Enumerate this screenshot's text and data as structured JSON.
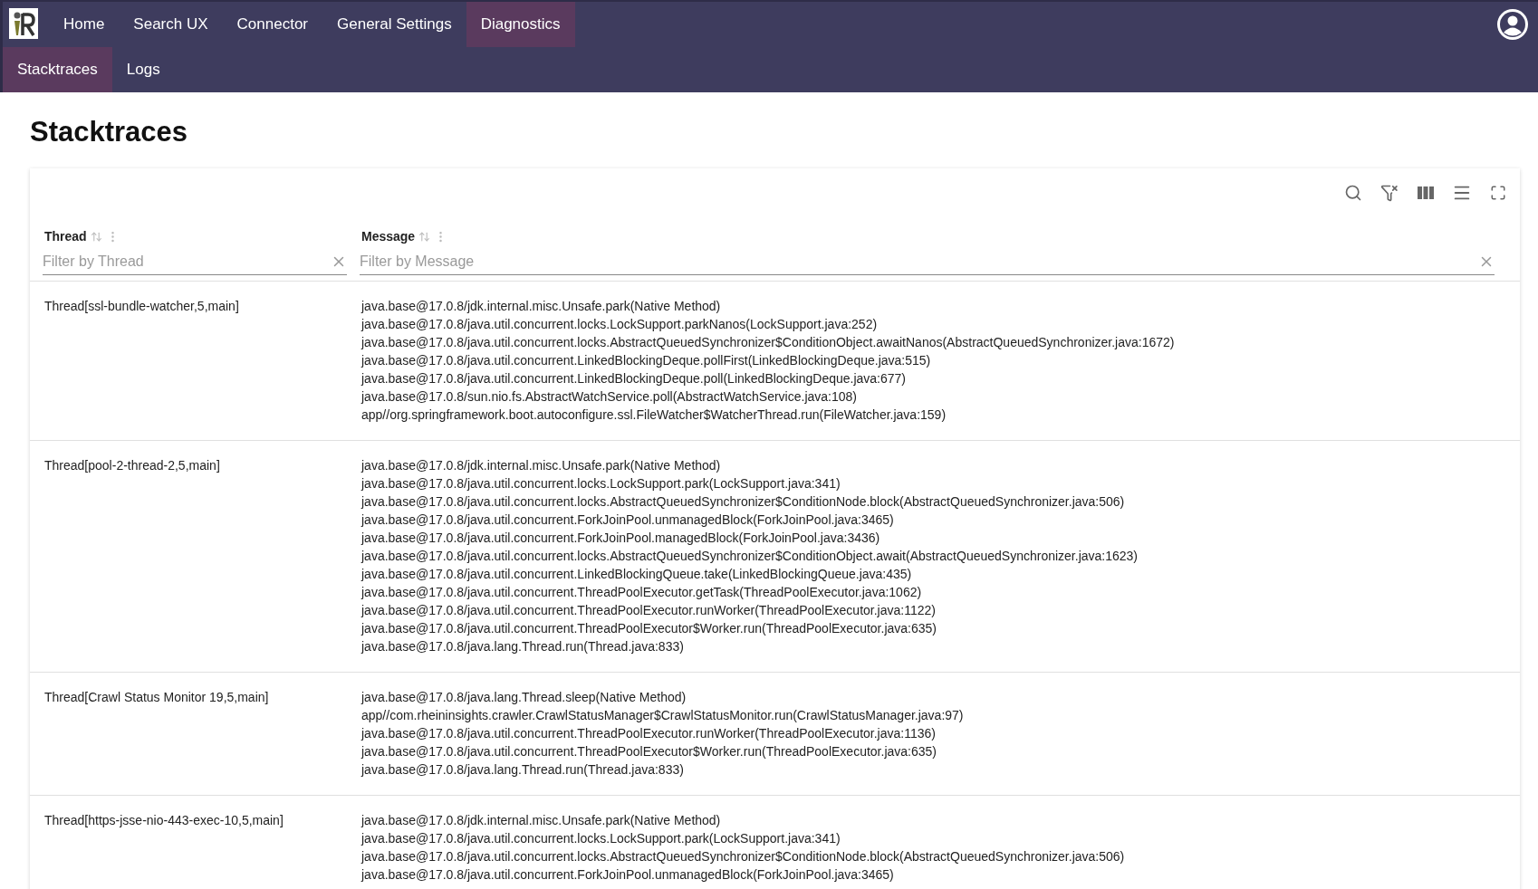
{
  "nav": {
    "tabs": [
      {
        "label": "Home",
        "selected": false
      },
      {
        "label": "Search UX",
        "selected": false
      },
      {
        "label": "Connector",
        "selected": false
      },
      {
        "label": "General Settings",
        "selected": false
      },
      {
        "label": "Diagnostics",
        "selected": true
      }
    ],
    "subtabs": [
      {
        "label": "Stacktraces",
        "selected": true
      },
      {
        "label": "Logs",
        "selected": false
      }
    ]
  },
  "page_title": "Stacktraces",
  "table": {
    "columns": [
      {
        "label": "Thread",
        "placeholder": "Filter by Thread"
      },
      {
        "label": "Message",
        "placeholder": "Filter by Message"
      }
    ],
    "rows": [
      {
        "thread": "Thread[ssl-bundle-watcher,5,main]",
        "message": [
          "java.base@17.0.8/jdk.internal.misc.Unsafe.park(Native Method)",
          "java.base@17.0.8/java.util.concurrent.locks.LockSupport.parkNanos(LockSupport.java:252)",
          "java.base@17.0.8/java.util.concurrent.locks.AbstractQueuedSynchronizer$ConditionObject.awaitNanos(AbstractQueuedSynchronizer.java:1672)",
          "java.base@17.0.8/java.util.concurrent.LinkedBlockingDeque.pollFirst(LinkedBlockingDeque.java:515)",
          "java.base@17.0.8/java.util.concurrent.LinkedBlockingDeque.poll(LinkedBlockingDeque.java:677)",
          "java.base@17.0.8/sun.nio.fs.AbstractWatchService.poll(AbstractWatchService.java:108)",
          "app//org.springframework.boot.autoconfigure.ssl.FileWatcher$WatcherThread.run(FileWatcher.java:159)"
        ]
      },
      {
        "thread": "Thread[pool-2-thread-2,5,main]",
        "message": [
          "java.base@17.0.8/jdk.internal.misc.Unsafe.park(Native Method)",
          "java.base@17.0.8/java.util.concurrent.locks.LockSupport.park(LockSupport.java:341)",
          "java.base@17.0.8/java.util.concurrent.locks.AbstractQueuedSynchronizer$ConditionNode.block(AbstractQueuedSynchronizer.java:506)",
          "java.base@17.0.8/java.util.concurrent.ForkJoinPool.unmanagedBlock(ForkJoinPool.java:3465)",
          "java.base@17.0.8/java.util.concurrent.ForkJoinPool.managedBlock(ForkJoinPool.java:3436)",
          "java.base@17.0.8/java.util.concurrent.locks.AbstractQueuedSynchronizer$ConditionObject.await(AbstractQueuedSynchronizer.java:1623)",
          "java.base@17.0.8/java.util.concurrent.LinkedBlockingQueue.take(LinkedBlockingQueue.java:435)",
          "java.base@17.0.8/java.util.concurrent.ThreadPoolExecutor.getTask(ThreadPoolExecutor.java:1062)",
          "java.base@17.0.8/java.util.concurrent.ThreadPoolExecutor.runWorker(ThreadPoolExecutor.java:1122)",
          "java.base@17.0.8/java.util.concurrent.ThreadPoolExecutor$Worker.run(ThreadPoolExecutor.java:635)",
          "java.base@17.0.8/java.lang.Thread.run(Thread.java:833)"
        ]
      },
      {
        "thread": "Thread[Crawl Status Monitor 19,5,main]",
        "message": [
          "java.base@17.0.8/java.lang.Thread.sleep(Native Method)",
          "app//com.rheininsights.crawler.CrawlStatusManager$CrawlStatusMonitor.run(CrawlStatusManager.java:97)",
          "java.base@17.0.8/java.util.concurrent.ThreadPoolExecutor.runWorker(ThreadPoolExecutor.java:1136)",
          "java.base@17.0.8/java.util.concurrent.ThreadPoolExecutor$Worker.run(ThreadPoolExecutor.java:635)",
          "java.base@17.0.8/java.lang.Thread.run(Thread.java:833)"
        ]
      },
      {
        "thread": "Thread[https-jsse-nio-443-exec-10,5,main]",
        "message": [
          "java.base@17.0.8/jdk.internal.misc.Unsafe.park(Native Method)",
          "java.base@17.0.8/java.util.concurrent.locks.LockSupport.park(LockSupport.java:341)",
          "java.base@17.0.8/java.util.concurrent.locks.AbstractQueuedSynchronizer$ConditionNode.block(AbstractQueuedSynchronizer.java:506)",
          "java.base@17.0.8/java.util.concurrent.ForkJoinPool.unmanagedBlock(ForkJoinPool.java:3465)"
        ]
      }
    ]
  }
}
